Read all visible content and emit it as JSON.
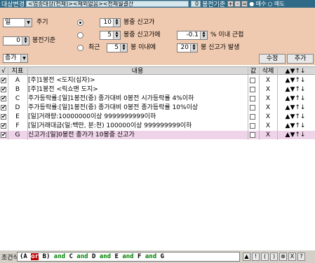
{
  "topbar": {
    "label": "대상변경",
    "target_field": "<업종대상(전체)><제외없음><전체월결산",
    "bong_value": "0",
    "bong_label": "봉전기준",
    "btn_plus": "+",
    "btn_minus": "-",
    "btn_eq": "=",
    "radio_buy": "● 매수",
    "radio_sell": "○ 매도"
  },
  "panel": {
    "period_select": "일",
    "period_label": "주기",
    "bong_before_value": "0",
    "bong_before_label": "봉전기준",
    "price_select": "종가",
    "row1_value": "10",
    "row1_label": "봉중 신고가",
    "row2_value": "5",
    "row2_label": "봉중 신고가에",
    "row2_pct": "-0.1",
    "row2_tail": "% 이내 근접",
    "row3_prefix": "최근",
    "row3_value": "5",
    "row3_mid": "봉 이내에",
    "row3_value2": "20",
    "row3_tail": "봉 신고가 발생",
    "edit_button": "수정",
    "add_button": "추가"
  },
  "table": {
    "headers": {
      "check": "√",
      "index": "지표",
      "content": "내용",
      "value": "값",
      "delete": "삭제",
      "order": "▲▼↑↓"
    },
    "rows": [
      {
        "checked": "✔",
        "index": "A",
        "content": "[주]1봉전 <도지(십자)>",
        "delete": "X",
        "order": "▲▼↑↓"
      },
      {
        "checked": "✔",
        "index": "B",
        "content": "[주]1봉전 <릭쇼맨 도지>",
        "delete": "X",
        "order": "▲▼↑↓"
      },
      {
        "checked": "✔",
        "index": "C",
        "content": "주가등락률:[일]1봉전(중) 종가대비 0봉전 시가등락률 4%이하",
        "delete": "X",
        "order": "▲▼↑↓"
      },
      {
        "checked": "✔",
        "index": "D",
        "content": "주가등락률:[일]1봉전(중) 종가대비 0봉전 종가등락률 10%이상",
        "delete": "X",
        "order": "▲▼↑↓"
      },
      {
        "checked": "✔",
        "index": "E",
        "content": "[일]거래량:10000000이상 9999999999이하",
        "delete": "X",
        "order": "▲▼↑↓"
      },
      {
        "checked": "✔",
        "index": "F",
        "content": "[일]거래대금(일:백만, 분:천) 100000이상 999999999이하",
        "delete": "X",
        "order": "▲▼↑↓"
      },
      {
        "checked": "✔",
        "index": "G",
        "content": "신고가:[일]0봉전 종가가 10봉중 신고가",
        "delete": "X",
        "order": "▲▼↑↓"
      }
    ]
  },
  "formula": {
    "label": "조건식",
    "tokens": [
      {
        "t": "(",
        "k": "b"
      },
      {
        "t": "A",
        "k": "b"
      },
      {
        "t": " ",
        "k": "n"
      },
      {
        "t": "or",
        "k": "or"
      },
      {
        "t": " ",
        "k": "n"
      },
      {
        "t": "B",
        "k": "b"
      },
      {
        "t": ")",
        "k": "b"
      },
      {
        "t": " and ",
        "k": "op"
      },
      {
        "t": "C",
        "k": "b"
      },
      {
        "t": " and ",
        "k": "op"
      },
      {
        "t": "D",
        "k": "b"
      },
      {
        "t": " and ",
        "k": "op"
      },
      {
        "t": "E",
        "k": "b"
      },
      {
        "t": " and ",
        "k": "op"
      },
      {
        "t": "F",
        "k": "b"
      },
      {
        "t": " and ",
        "k": "op"
      },
      {
        "t": "G",
        "k": "b"
      }
    ],
    "buttons": [
      "▲",
      "!",
      "(",
      ")",
      "⊗",
      "X",
      "?"
    ]
  },
  "colors": {
    "topbar": "#2f6a86",
    "panel": "#f0cab0",
    "selected_row": "#efd3e8",
    "operator": "#008000",
    "or_highlight": "#c00000"
  }
}
